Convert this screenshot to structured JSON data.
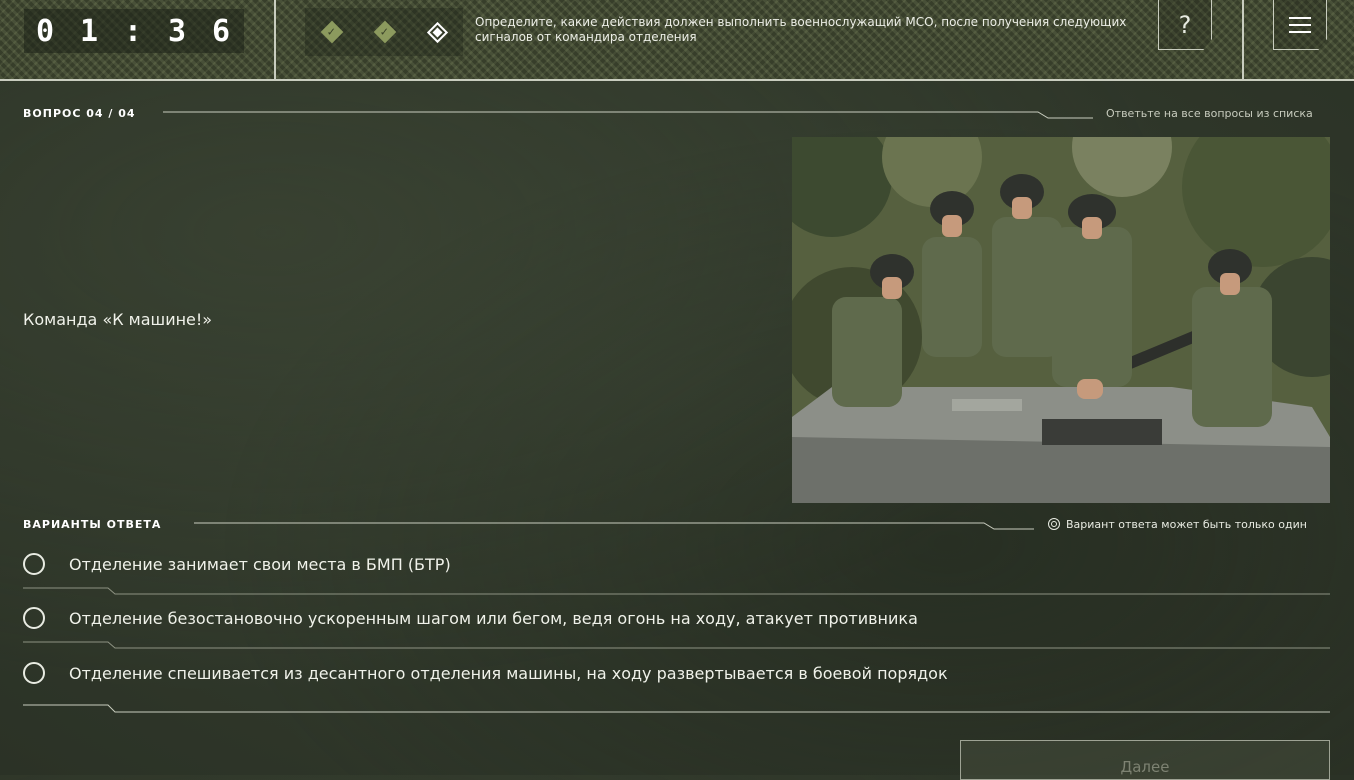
{
  "header": {
    "timer": [
      "0",
      "1",
      ":",
      "3",
      "6"
    ],
    "progress": [
      {
        "state": "done",
        "icon": "check-icon"
      },
      {
        "state": "done",
        "icon": "check-icon"
      },
      {
        "state": "current",
        "icon": "diamond-icon"
      }
    ],
    "instruction": "Определите, какие действия должен выполнить военнослужащий МСО, после получения следующих сигналов от командира отделения",
    "help_label": "?"
  },
  "question": {
    "counter_label": "ВОПРОС  04 / 04",
    "hint": "Ответьте на все вопросы из списка",
    "text": "Команда «К машине!»",
    "image_icon": "soldiers-on-apc-photo"
  },
  "answers": {
    "section_label": "ВАРИАНТЫ ОТВЕТА",
    "note": "Вариант ответа может быть только один",
    "options": [
      "Отделение занимает свои места в БМП (БТР)",
      "Отделение безостановочно ускоренным шагом или бегом, ведя огонь на ходу, атакует противника",
      "Отделение спешивается из десантного отделения машины, на ходу развертывается в боевой порядок"
    ]
  },
  "footer": {
    "next_label": "Далее"
  },
  "colors": {
    "background": "#323a2c",
    "header_camo": "#4a5238",
    "progress_done": "#8c9a5e",
    "line": "#c9cdbf"
  }
}
